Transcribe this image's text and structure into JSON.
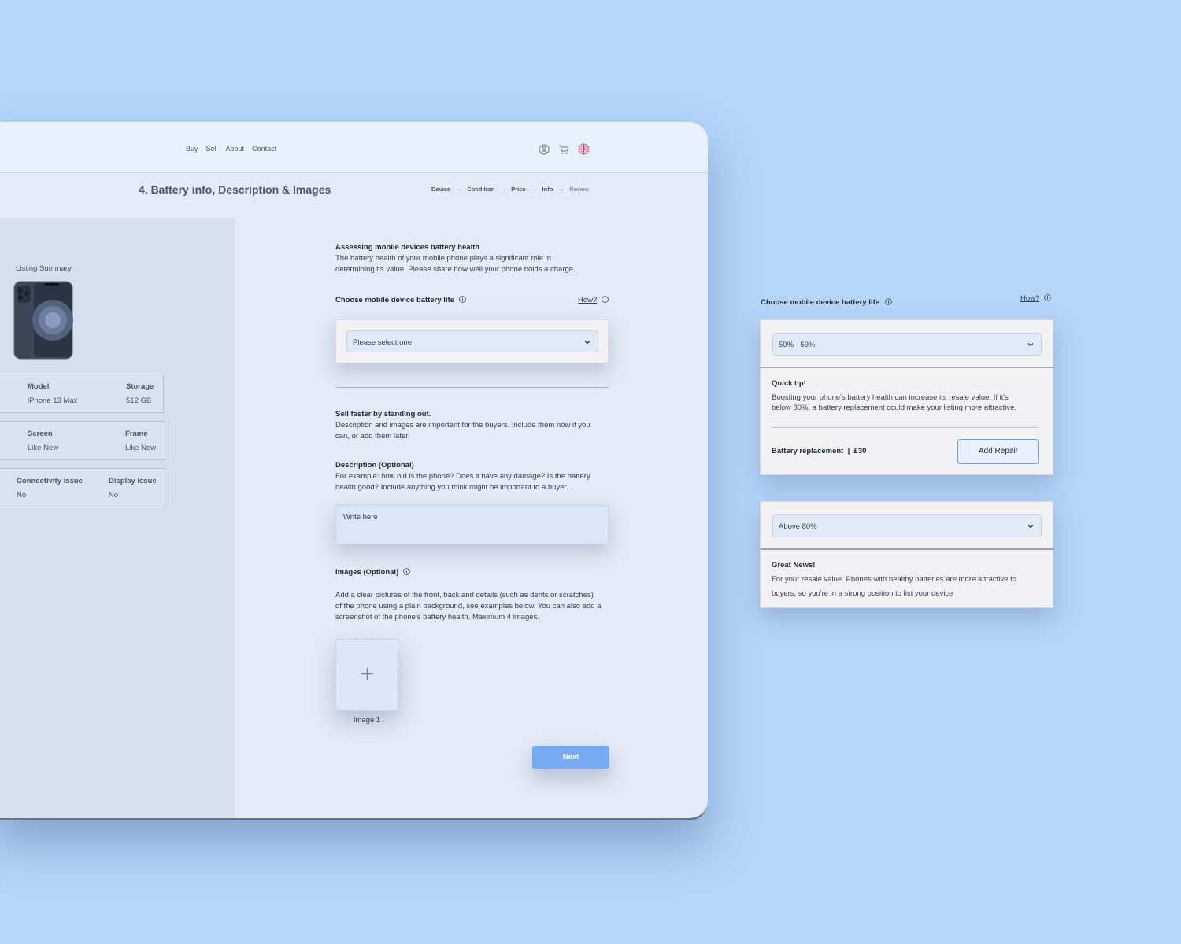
{
  "nav": {
    "links": [
      "Buy",
      "Sell",
      "About",
      "Contact"
    ],
    "icons": [
      "user-icon",
      "cart-icon",
      "uk-flag-icon"
    ]
  },
  "page": {
    "title": "4. Battery info, Description & Images",
    "steps": [
      "Device",
      "Condition",
      "Price",
      "Info",
      "Review"
    ]
  },
  "sidebar": {
    "summary_label": "Listing Summary",
    "specs": [
      {
        "label_a": "Model",
        "value_a": "iPhone 13 Max",
        "label_b": "Storage",
        "value_b": "512 GB"
      },
      {
        "label_a": "Screen",
        "value_a": "Like New",
        "label_b": "Frame",
        "value_b": "Like New"
      },
      {
        "label_a": "Connectivity issue",
        "value_a": "No",
        "label_b": "Display issue",
        "value_b": "No"
      }
    ]
  },
  "battery": {
    "heading": "Assessing mobile devices battery health",
    "desc_line1": "The battery health  of your mobile phone plays a significant role in",
    "desc_line2": "determining its value. Please share how well your phone holds a charge.",
    "select_label": "Choose mobile device battery life",
    "how_link": "How?",
    "select_placeholder": "Please select one"
  },
  "standout": {
    "heading": "Sell faster by standing out.",
    "line1": "Description and images are important for the buyers. Include them now if you",
    "line2": "can, or add them later."
  },
  "description": {
    "heading": "Description (Optional)",
    "line1": "For example: how old is the phone? Does it have any damage? Is the battery",
    "line2": "health good? Include anything you think might be important to a buyer.",
    "placeholder": "Write here"
  },
  "images": {
    "heading": "Images (Optional)",
    "line1": "Add a clear pictures of the front, back and details (such as dents or scratches)",
    "line2": "of the phone using a plain background, see examples below. You can also add a",
    "line3": "screenshot of the phone's battery health. Maximum 4 images.",
    "slot_label": "Image 1"
  },
  "next_label": "Next",
  "panel_a": {
    "select_label": "Choose mobile device battery life",
    "how_link": "How?",
    "selected": "50% - 59%",
    "tip_heading": "Quick tip!",
    "tip_line1": "Boosting your phone's battery health can increase its resale value. If it's",
    "tip_line2": "below 80%, a battery replacement could make your listing more attractive.",
    "repair_text": "Battery replacement  |  £30",
    "repair_button": "Add Repair"
  },
  "panel_b": {
    "selected": "Above 80%",
    "news_heading": "Great News!",
    "news_line1": "For your resale value. Phones with healthy batteries are more attractive to",
    "news_line2": "buyers, so you're in a strong position to list your device"
  }
}
